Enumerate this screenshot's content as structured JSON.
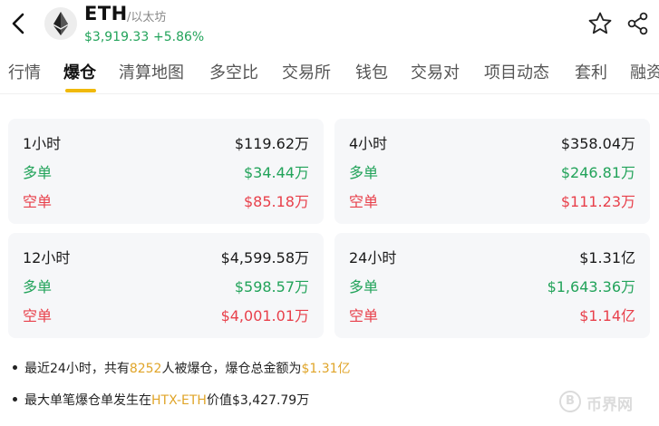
{
  "header": {
    "symbol": "ETH",
    "name": "/以太坊",
    "price": "$3,919.33",
    "change": "+5.86%",
    "colors": {
      "up": "#22a35a",
      "down": "#e8404b",
      "accent": "#f0b90b"
    }
  },
  "tabs": [
    {
      "label": "行情"
    },
    {
      "label": "爆仓"
    },
    {
      "label": "清算地图"
    },
    {
      "label": "多空比"
    },
    {
      "label": "交易所"
    },
    {
      "label": "钱包"
    },
    {
      "label": "交易对"
    },
    {
      "label": "项目动态"
    },
    {
      "label": "套利"
    },
    {
      "label": "融资"
    }
  ],
  "liquidations": [
    {
      "period": "1小时",
      "total": "$119.62万",
      "long_label": "多单",
      "long": "$34.44万",
      "short_label": "空单",
      "short": "$85.18万"
    },
    {
      "period": "4小时",
      "total": "$358.04万",
      "long_label": "多单",
      "long": "$246.81万",
      "short_label": "空单",
      "short": "$111.23万"
    },
    {
      "period": "12小时",
      "total": "$4,599.58万",
      "long_label": "多单",
      "long": "$598.57万",
      "short_label": "空单",
      "short": "$4,001.01万"
    },
    {
      "period": "24小时",
      "total": "$1.31亿",
      "long_label": "多单",
      "long": "$1,643.36万",
      "short_label": "空单",
      "short": "$1.14亿"
    }
  ],
  "summary": {
    "line1_a": "最近24小时，共有",
    "line1_count": "8252",
    "line1_b": "人被爆仓，爆仓总金额为",
    "line1_amount": "$1.31亿",
    "line2_a": "最大单笔爆仓单发生在",
    "line2_exchange": "HTX-ETH",
    "line2_b": "价值$3,427.79万"
  },
  "watermark": {
    "text": "币界网",
    "symbol": "B"
  },
  "icons": {
    "back": "chevron-left-icon",
    "logo": "ethereum-logo-icon",
    "favorite": "star-icon",
    "share": "share-icon"
  }
}
